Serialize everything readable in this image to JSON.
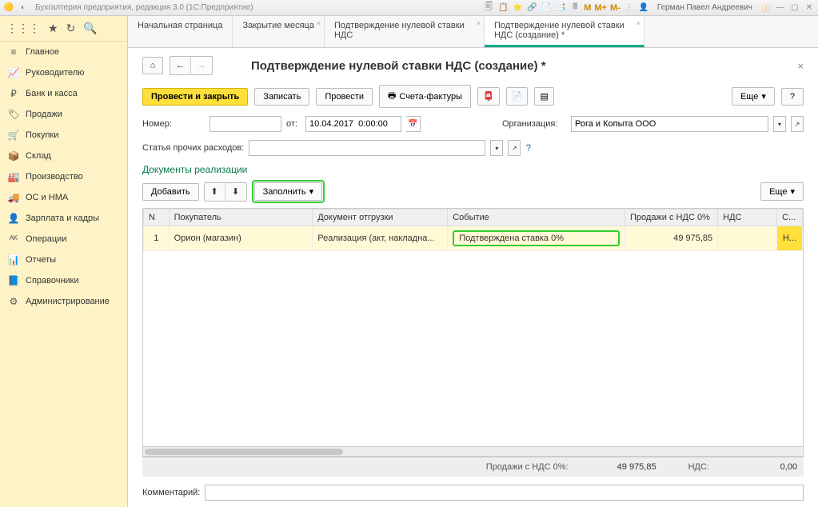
{
  "titlebar": {
    "app_title": "Бухгалтерия предприятия, редакция 3.0  (1С:Предприятие)",
    "user": "Герман Павел Андреевич",
    "m_small": "M",
    "m_plus": "M+",
    "m_minus": "M-"
  },
  "sidebar": {
    "items": [
      {
        "icon": "≡",
        "label": "Главное"
      },
      {
        "icon": "📈",
        "label": "Руководителю"
      },
      {
        "icon": "₽",
        "label": "Банк и касса"
      },
      {
        "icon": "🏷",
        "label": "Продажи"
      },
      {
        "icon": "🛒",
        "label": "Покупки"
      },
      {
        "icon": "📦",
        "label": "Склад"
      },
      {
        "icon": "🏭",
        "label": "Производство"
      },
      {
        "icon": "🚚",
        "label": "ОС и НМА"
      },
      {
        "icon": "👤",
        "label": "Зарплата и кадры"
      },
      {
        "icon": "ᴬᴷ",
        "label": "Операции"
      },
      {
        "icon": "📊",
        "label": "Отчеты"
      },
      {
        "icon": "📘",
        "label": "Справочники"
      },
      {
        "icon": "⚙",
        "label": "Администрирование"
      }
    ]
  },
  "tabs": [
    {
      "label": "Начальная страница",
      "closable": false
    },
    {
      "label": "Закрытие месяца",
      "closable": true
    },
    {
      "label": "Подтверждение нулевой ставки НДС",
      "closable": true
    },
    {
      "label": "Подтверждение нулевой ставки НДС (создание) *",
      "closable": true,
      "active": true
    }
  ],
  "doc": {
    "title": "Подтверждение нулевой ставки НДС (создание) *",
    "actions": {
      "post_and_close": "Провести и закрыть",
      "save": "Записать",
      "post": "Провести",
      "invoices": "Счета-фактуры",
      "more": "Еще",
      "help": "?"
    },
    "form": {
      "number_label": "Номер:",
      "number_value": "",
      "date_label": "от:",
      "date_value": "10.04.2017  0:00:00",
      "org_label": "Организация:",
      "org_value": "Рога и Копыта ООО",
      "expense_label": "Статья прочих расходов:",
      "expense_value": ""
    },
    "section_title": "Документы реализации",
    "tbl_toolbar": {
      "add": "Добавить",
      "fill": "Заполнить",
      "more": "Еще"
    },
    "columns": {
      "n": "N",
      "buyer": "Покупатель",
      "shipment": "Документ отгрузки",
      "event": "Событие",
      "sales": "Продажи с НДС 0%",
      "nds": "НДС",
      "last": "С..."
    },
    "rows": [
      {
        "n": "1",
        "buyer": "Орион (магазин)",
        "shipment": "Реализация (акт, накладна...",
        "event": "Подтверждена ставка 0%",
        "sales": "49 975,85",
        "nds": "",
        "last": "Н..."
      }
    ],
    "totals": {
      "sales_label": "Продажи с НДС 0%:",
      "sales_value": "49 975,85",
      "nds_label": "НДС:",
      "nds_value": "0,00"
    },
    "comment_label": "Комментарий:",
    "comment_value": ""
  }
}
